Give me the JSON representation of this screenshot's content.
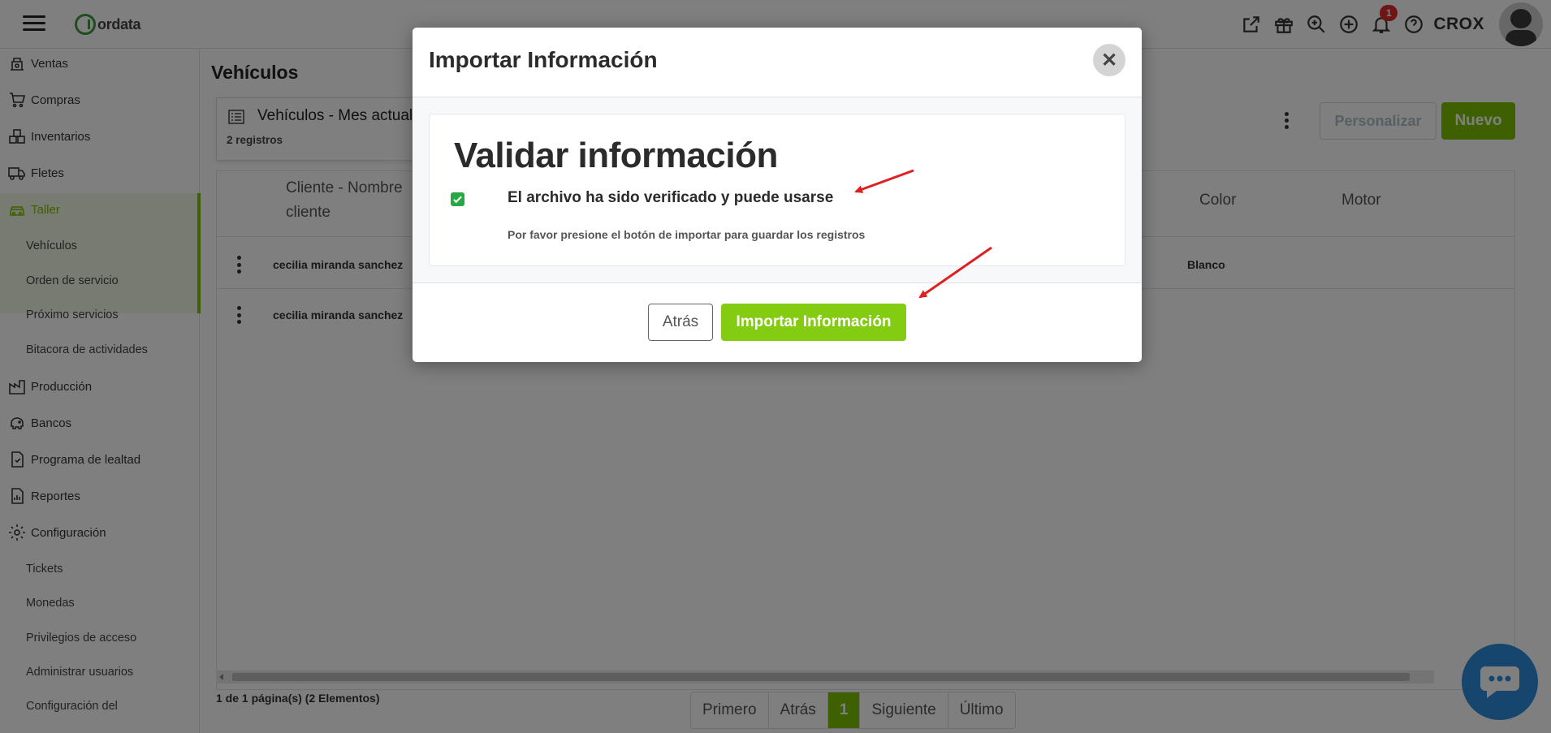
{
  "app": {
    "logo_text": "ordata",
    "user_name": "CROX",
    "notification_count": "1"
  },
  "sidebar": {
    "items": [
      {
        "label": "Ventas",
        "icon": "cash-register-icon"
      },
      {
        "label": "Compras",
        "icon": "cart-icon"
      },
      {
        "label": "Inventarios",
        "icon": "boxes-icon"
      },
      {
        "label": "Fletes",
        "icon": "truck-icon"
      },
      {
        "label": "Taller",
        "icon": "car-icon",
        "active": true
      },
      {
        "label": "Vehículos",
        "sub": true
      },
      {
        "label": "Orden de servicio",
        "sub": true
      },
      {
        "label": "Próximo servicios",
        "sub": true
      },
      {
        "label": "Bitacora de actividades",
        "sub": true
      },
      {
        "label": "Producción",
        "icon": "factory-icon"
      },
      {
        "label": "Bancos",
        "icon": "piggy-bank-icon"
      },
      {
        "label": "Programa de lealtad",
        "icon": "loyalty-icon"
      },
      {
        "label": "Reportes",
        "icon": "report-icon"
      },
      {
        "label": "Configuración",
        "icon": "gear-icon"
      },
      {
        "label": "Tickets",
        "sub": true
      },
      {
        "label": "Monedas",
        "sub": true
      },
      {
        "label": "Privilegios de acceso",
        "sub": true
      },
      {
        "label": "Administrar usuarios",
        "sub": true
      },
      {
        "label": "Configuración del",
        "sub": true
      }
    ]
  },
  "page": {
    "title": "Vehículos",
    "view_select_label": "Vehículos - Mes actual",
    "record_count": "2 registros",
    "btn_personalizar": "Personalizar",
    "btn_nuevo": "Nuevo"
  },
  "table": {
    "headers": {
      "cliente_line1": "Cliente - Nombre",
      "cliente_line2": "cliente",
      "color": "Color",
      "motor": "Motor"
    },
    "rows": [
      {
        "cliente": "cecilia miranda sanchez",
        "color": "Blanco"
      },
      {
        "cliente": "cecilia miranda sanchez",
        "color": ""
      }
    ]
  },
  "pagination": {
    "info": "1 de 1 página(s) (2 Elementos)",
    "first": "Primero",
    "prev": "Atrás",
    "current": "1",
    "next": "Siguiente",
    "last": "Último"
  },
  "modal": {
    "title": "Importar Información",
    "close_symbol": "✕",
    "section_title": "Validar información",
    "verified_text": "El archivo ha sido verificado y puede usarse",
    "hint_text": "Por favor presione el botón de importar para guardar los registros",
    "btn_back": "Atrás",
    "btn_import": "Importar Información"
  },
  "colors": {
    "accent_green": "#7cc000",
    "import_button_green": "#84cc12",
    "check_green": "#28a745",
    "annotation_red": "#e02020",
    "chat_blue": "#2c8cdb"
  }
}
